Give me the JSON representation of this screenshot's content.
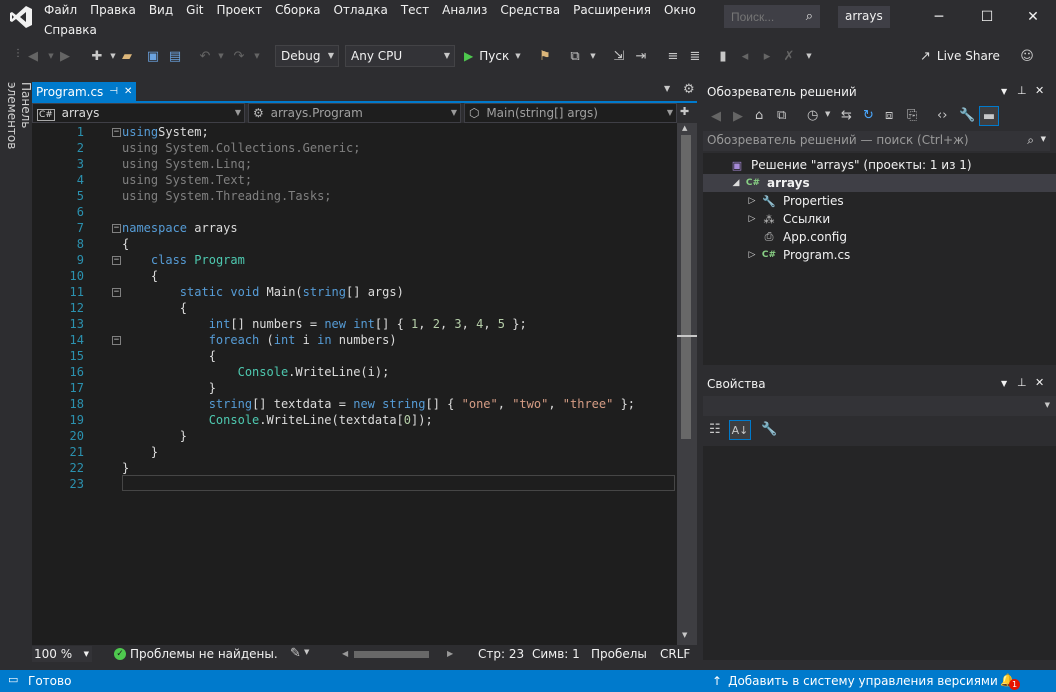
{
  "menu": {
    "items": [
      "Файл",
      "Правка",
      "Вид",
      "Git",
      "Проект",
      "Сборка",
      "Отладка",
      "Тест",
      "Анализ",
      "Средства",
      "Расширения",
      "Окно",
      "Справка"
    ],
    "search_placeholder": "Поиск...",
    "solution_name": "arrays"
  },
  "toolbar": {
    "config": "Debug",
    "platform": "Any CPU",
    "run_label": "Пуск",
    "live_share": "Live Share"
  },
  "side_tab": "Панель элементов",
  "editor": {
    "tab_name": "Program.cs",
    "nav": {
      "project": "arrays",
      "class": "arrays.Program",
      "member": "Main(string[] args)"
    },
    "line_numbers": [
      "1",
      "2",
      "3",
      "4",
      "5",
      "6",
      "7",
      "8",
      "9",
      "10",
      "11",
      "12",
      "13",
      "14",
      "15",
      "16",
      "17",
      "18",
      "19",
      "20",
      "21",
      "22",
      "23"
    ],
    "code": [
      [
        [
          "kw",
          "using"
        ],
        [
          "",
          "System;"
        ]
      ],
      [
        [
          "fa",
          "using System.Collections.Generic;"
        ]
      ],
      [
        [
          "fa",
          "using System.Linq;"
        ]
      ],
      [
        [
          "fa",
          "using System.Text;"
        ]
      ],
      [
        [
          "fa",
          "using System.Threading.Tasks;"
        ]
      ],
      [],
      [
        [
          "kw",
          "namespace"
        ],
        [
          "",
          " arrays"
        ]
      ],
      [
        [
          "",
          "{"
        ]
      ],
      [
        [
          "",
          "    "
        ],
        [
          "kw",
          "class"
        ],
        [
          "",
          " "
        ],
        [
          "ty",
          "Program"
        ]
      ],
      [
        [
          "",
          "    {"
        ]
      ],
      [
        [
          "",
          "        "
        ],
        [
          "kw",
          "static"
        ],
        [
          "",
          " "
        ],
        [
          "kw",
          "void"
        ],
        [
          "",
          " Main("
        ],
        [
          "kw",
          "string"
        ],
        [
          "",
          "[] args)"
        ]
      ],
      [
        [
          "",
          "        {"
        ]
      ],
      [
        [
          "",
          "            "
        ],
        [
          "kw",
          "int"
        ],
        [
          "",
          "[] numbers = "
        ],
        [
          "kw",
          "new"
        ],
        [
          "",
          " "
        ],
        [
          "kw",
          "int"
        ],
        [
          "",
          "[] { "
        ],
        [
          "nu",
          "1"
        ],
        [
          "",
          ", "
        ],
        [
          "nu",
          "2"
        ],
        [
          "",
          ", "
        ],
        [
          "nu",
          "3"
        ],
        [
          "",
          ", "
        ],
        [
          "nu",
          "4"
        ],
        [
          "",
          ", "
        ],
        [
          "nu",
          "5"
        ],
        [
          "",
          " };"
        ]
      ],
      [
        [
          "",
          "            "
        ],
        [
          "kw",
          "foreach"
        ],
        [
          "",
          " ("
        ],
        [
          "kw",
          "int"
        ],
        [
          "",
          " i "
        ],
        [
          "kw",
          "in"
        ],
        [
          "",
          " numbers)"
        ]
      ],
      [
        [
          "",
          "            {"
        ]
      ],
      [
        [
          "",
          "                "
        ],
        [
          "ty",
          "Console"
        ],
        [
          "",
          "."
        ],
        [
          "",
          "WriteLine(i);"
        ]
      ],
      [
        [
          "",
          "            }"
        ]
      ],
      [
        [
          "",
          "            "
        ],
        [
          "kw",
          "string"
        ],
        [
          "",
          "[] textdata = "
        ],
        [
          "kw",
          "new"
        ],
        [
          "",
          " "
        ],
        [
          "kw",
          "string"
        ],
        [
          "",
          "[] { "
        ],
        [
          "st",
          "\"one\""
        ],
        [
          "",
          ", "
        ],
        [
          "st",
          "\"two\""
        ],
        [
          "",
          ", "
        ],
        [
          "st",
          "\"three\""
        ],
        [
          "",
          " };"
        ]
      ],
      [
        [
          "",
          "            "
        ],
        [
          "ty",
          "Console"
        ],
        [
          "",
          ".WriteLine(textdata["
        ],
        [
          "nu",
          "0"
        ],
        [
          "",
          "]);"
        ]
      ],
      [
        [
          "",
          "        }"
        ]
      ],
      [
        [
          "",
          "    }"
        ]
      ],
      [
        [
          "",
          "}"
        ]
      ],
      []
    ],
    "zoom": "100 %",
    "problems": "Проблемы не найдены.",
    "line": "Стр: 23",
    "col": "Симв: 1",
    "spaces": "Пробелы",
    "eol": "CRLF"
  },
  "solution_explorer": {
    "title": "Обозреватель решений",
    "search_placeholder": "Обозреватель решений — поиск (Ctrl+ж)",
    "tree": [
      {
        "label": "Решение \"arrays\" (проекты: 1 из 1)",
        "icon": "solution-icon",
        "indent": 0,
        "expander": ""
      },
      {
        "label": "arrays",
        "icon": "csharp-project-icon",
        "indent": 1,
        "expander": "◢",
        "bold": true,
        "selected": true
      },
      {
        "label": "Properties",
        "icon": "wrench-icon",
        "indent": 2,
        "expander": "▷"
      },
      {
        "label": "Ссылки",
        "icon": "references-icon",
        "indent": 2,
        "expander": "▷"
      },
      {
        "label": "App.config",
        "icon": "config-file-icon",
        "indent": 2,
        "expander": ""
      },
      {
        "label": "Program.cs",
        "icon": "csharp-file-icon",
        "indent": 2,
        "expander": "▷"
      }
    ]
  },
  "properties": {
    "title": "Свойства"
  },
  "status": {
    "ready": "Готово",
    "source_control": "Добавить в систему управления версиями",
    "notifications": "1"
  },
  "colors": {
    "accent": "#007acc",
    "keyword": "#569cd6",
    "type": "#4ec9b0",
    "string": "#d69d85",
    "number": "#b5cea8",
    "line_number": "#2b91af"
  }
}
